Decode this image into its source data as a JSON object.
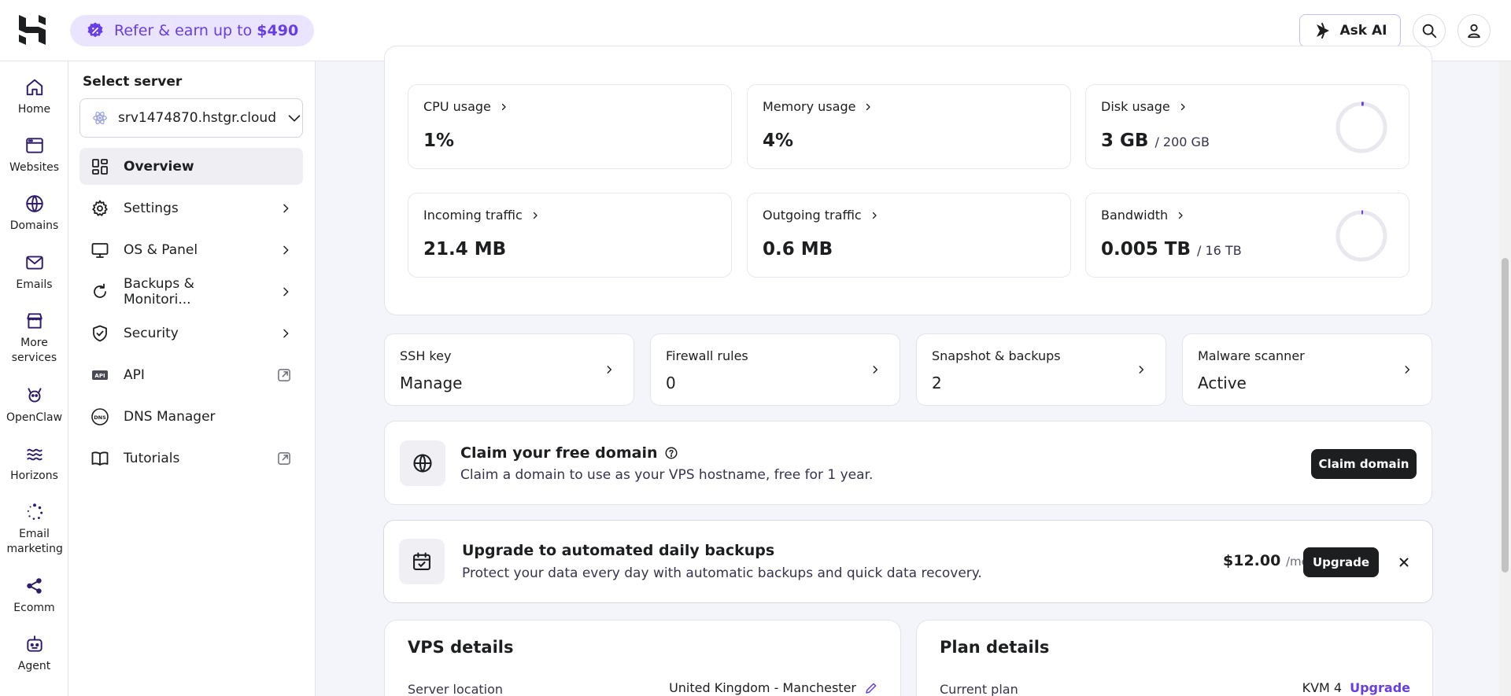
{
  "topbar": {
    "refer_label": "Refer & earn up to",
    "refer_amount": "$490",
    "ask_ai_label": "Ask AI"
  },
  "rail": [
    {
      "label": "Home",
      "icon": "home-icon"
    },
    {
      "label": "Websites",
      "icon": "websites-icon"
    },
    {
      "label": "Domains",
      "icon": "globe-icon"
    },
    {
      "label": "Emails",
      "icon": "mail-icon"
    },
    {
      "label": "More services",
      "icon": "store-icon"
    },
    {
      "label": "OpenClaw",
      "icon": "claw-icon"
    },
    {
      "label": "Horizons",
      "icon": "horizons-icon"
    },
    {
      "label": "Email marketing",
      "icon": "email-marketing-icon"
    },
    {
      "label": "Ecomm",
      "icon": "ecomm-icon"
    },
    {
      "label": "Agent",
      "icon": "agent-icon"
    }
  ],
  "sidebar": {
    "title": "Select server",
    "server": "srv1474870.hstgr.cloud",
    "items": [
      {
        "label": "Overview",
        "icon": "overview-icon",
        "tail": "none"
      },
      {
        "label": "Settings",
        "icon": "gear-icon",
        "tail": "chevron"
      },
      {
        "label": "OS & Panel",
        "icon": "monitor-icon",
        "tail": "chevron"
      },
      {
        "label": "Backups & Monitori...",
        "icon": "refresh-icon",
        "tail": "chevron"
      },
      {
        "label": "Security",
        "icon": "shield-icon",
        "tail": "chevron"
      },
      {
        "label": "API",
        "icon": "api-icon",
        "tail": "external"
      },
      {
        "label": "DNS Manager",
        "icon": "dns-icon",
        "tail": "none"
      },
      {
        "label": "Tutorials",
        "icon": "book-icon",
        "tail": "external"
      }
    ]
  },
  "stats": [
    {
      "label": "CPU usage",
      "value": "1%",
      "sub": ""
    },
    {
      "label": "Memory usage",
      "value": "4%",
      "sub": ""
    },
    {
      "label": "Disk usage",
      "value": "3 GB",
      "sub": "/ 200 GB",
      "ring_fraction": 0.015
    },
    {
      "label": "Incoming traffic",
      "value": "21.4 MB",
      "sub": ""
    },
    {
      "label": "Outgoing traffic",
      "value": "0.6 MB",
      "sub": ""
    },
    {
      "label": "Bandwidth",
      "value": "0.005 TB",
      "sub": "/ 16 TB",
      "ring_fraction": 0.0003
    }
  ],
  "quick": [
    {
      "label": "SSH key",
      "value": "Manage"
    },
    {
      "label": "Firewall rules",
      "value": "0"
    },
    {
      "label": "Snapshot & backups",
      "value": "2"
    },
    {
      "label": "Malware scanner",
      "value": "Active"
    }
  ],
  "domain_banner": {
    "title": "Claim your free domain",
    "text": "Claim a domain to use as your VPS hostname, free for 1 year.",
    "button": "Claim domain"
  },
  "backup_banner": {
    "title": "Upgrade to automated daily backups",
    "text": "Protect your data every day with automatic backups and quick data recovery.",
    "price": "$12.00",
    "per": "/mo",
    "button": "Upgrade"
  },
  "vps_details": {
    "title": "VPS details",
    "row_label": "Server location",
    "row_value": "United Kingdom - Manchester"
  },
  "plan_details": {
    "title": "Plan details",
    "row_label": "Current plan",
    "row_value": "KVM 4",
    "row_link": "Upgrade"
  },
  "colors": {
    "accent": "#673de6",
    "accent_soft": "#ebe4ff",
    "dark": "#1d1e20"
  }
}
